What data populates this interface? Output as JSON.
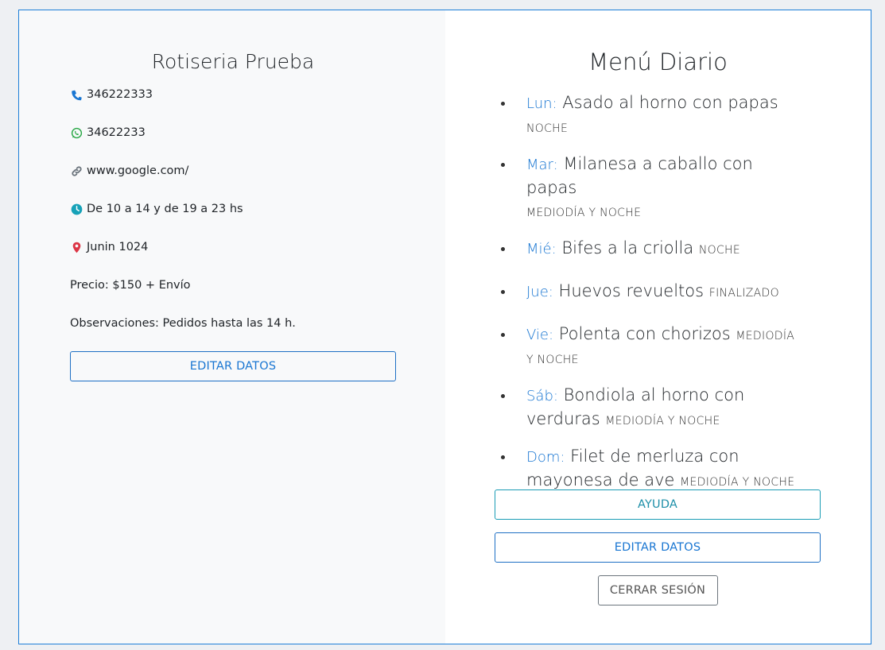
{
  "business": {
    "name": "Rotiseria Prueba",
    "phone": "346222333",
    "whatsapp": "34622233",
    "website": "www.google.com/",
    "hours": "De 10 a 14 y de 19 a 23 hs",
    "address": "Junin 1024",
    "price": "Precio: $150 + Envío",
    "notes": "Observaciones: Pedidos hasta las 14 h.",
    "edit_label": "EDITAR DATOS"
  },
  "menu": {
    "title": "Menú Diario",
    "items": [
      {
        "day": "Lun:",
        "dish": "Asado al horno con papas",
        "shift": "NOCHE",
        "break": true
      },
      {
        "day": "Mar:",
        "dish": "Milanesa a caballo con papas",
        "shift": "MEDIODÍA Y NOCHE",
        "break": true
      },
      {
        "day": "Mié:",
        "dish": "Bifes a la criolla",
        "shift": "NOCHE",
        "break": false
      },
      {
        "day": "Jue:",
        "dish": "Huevos revueltos",
        "shift": "FINALIZADO",
        "break": false
      },
      {
        "day": "Vie:",
        "dish": "Polenta con chorizos",
        "shift": "MEDIODÍA Y NOCHE",
        "break": false
      },
      {
        "day": "Sáb:",
        "dish": "Bondiola al horno con verduras",
        "shift": "MEDIODÍA Y NOCHE",
        "break": false
      },
      {
        "day": "Dom:",
        "dish": "Filet de merluza con mayonesa de ave",
        "shift": "MEDIODÍA Y NOCHE",
        "break": false
      }
    ],
    "help_label": "AYUDA",
    "edit_label": "EDITAR DATOS",
    "logout_label": "CERRAR SESIÓN"
  },
  "colors": {
    "accent": "#1976d2",
    "phone_icon": "#1976d2",
    "whatsapp_icon": "#28a745",
    "link_icon": "#6c757d",
    "clock_icon": "#17a2b8",
    "location_icon": "#dc3545"
  }
}
